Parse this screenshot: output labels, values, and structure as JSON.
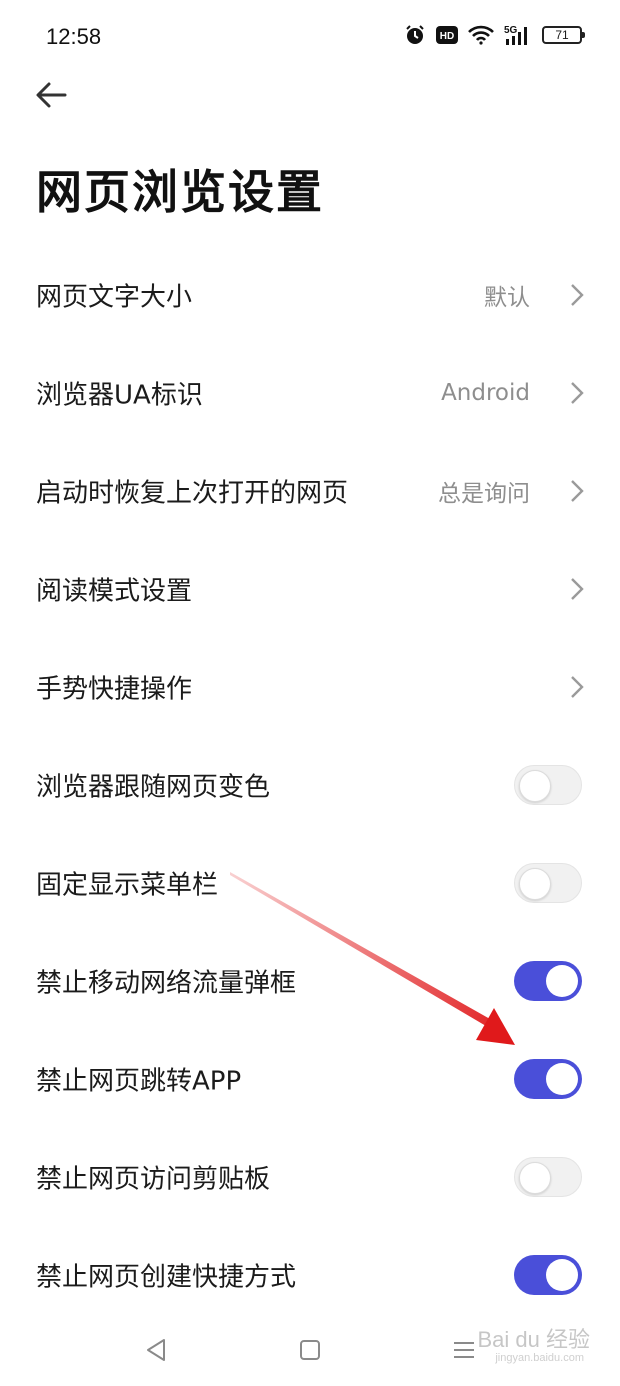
{
  "status_bar": {
    "time": "12:58",
    "network": "5G",
    "battery": "71",
    "icons": [
      "alarm-icon",
      "hd-icon",
      "wifi-icon",
      "signal-5g-icon",
      "battery-icon"
    ]
  },
  "header": {
    "back_icon": "back-arrow-icon",
    "title": "网页浏览设置"
  },
  "settings": [
    {
      "label": "网页文字大小",
      "type": "nav",
      "value": "默认"
    },
    {
      "label": "浏览器UA标识",
      "type": "nav",
      "value": "Android"
    },
    {
      "label": "启动时恢复上次打开的网页",
      "type": "nav",
      "value": "总是询问"
    },
    {
      "label": "阅读模式设置",
      "type": "nav",
      "value": ""
    },
    {
      "label": "手势快捷操作",
      "type": "nav",
      "value": ""
    },
    {
      "label": "浏览器跟随网页变色",
      "type": "toggle",
      "on": false
    },
    {
      "label": "固定显示菜单栏",
      "type": "toggle",
      "on": false
    },
    {
      "label": "禁止移动网络流量弹框",
      "type": "toggle",
      "on": true
    },
    {
      "label": "禁止网页跳转APP",
      "type": "toggle",
      "on": true
    },
    {
      "label": "禁止网页访问剪贴板",
      "type": "toggle",
      "on": false
    },
    {
      "label": "禁止网页创建快捷方式",
      "type": "toggle",
      "on": true
    }
  ],
  "colors": {
    "toggle_on": "#4a4fd9",
    "toggle_off": "#f1f1f1",
    "annotation_arrow": "#e0191b"
  },
  "nav_bar": {
    "icons": [
      "back-triangle-icon",
      "home-square-icon",
      "menu-lines-icon"
    ]
  },
  "watermark": {
    "text": "Bai du 经验",
    "sub": "jingyan.baidu.com"
  }
}
